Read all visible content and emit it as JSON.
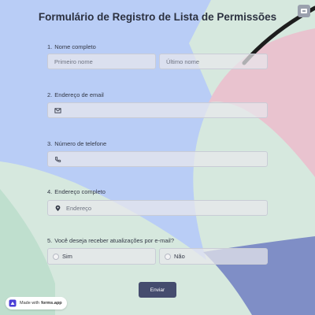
{
  "form": {
    "title": "Formulário de Registro de Lista de Permissões",
    "questions": [
      {
        "number": "1.",
        "label": "Nome completo"
      },
      {
        "number": "2.",
        "label": "Endereço de email"
      },
      {
        "number": "3.",
        "label": "Número de telefone"
      },
      {
        "number": "4.",
        "label": "Endereço completo"
      },
      {
        "number": "5.",
        "label": "Você deseja receber atualizações por e-mail?"
      }
    ],
    "first_name_placeholder": "Primeiro nome",
    "last_name_placeholder": "Último nome",
    "email_value": "",
    "phone_value": "",
    "address_placeholder": "Endereço",
    "options": [
      "Sim",
      "Não"
    ],
    "submit_label": "Enviar"
  },
  "badge": {
    "prefix": "Made with",
    "brand": "forms.app"
  },
  "icons": {
    "top_right": "screen-icon",
    "email": "envelope-icon",
    "phone": "phone-icon",
    "address": "location-pin-icon",
    "badge": "forms-app-logo-icon"
  },
  "colors": {
    "background": "#d6e8de",
    "blue_shape": "#b9cdf6",
    "pink_shape": "#e9c3cf",
    "indigo_shape": "#7f8ec6",
    "submit": "#454c6e"
  }
}
